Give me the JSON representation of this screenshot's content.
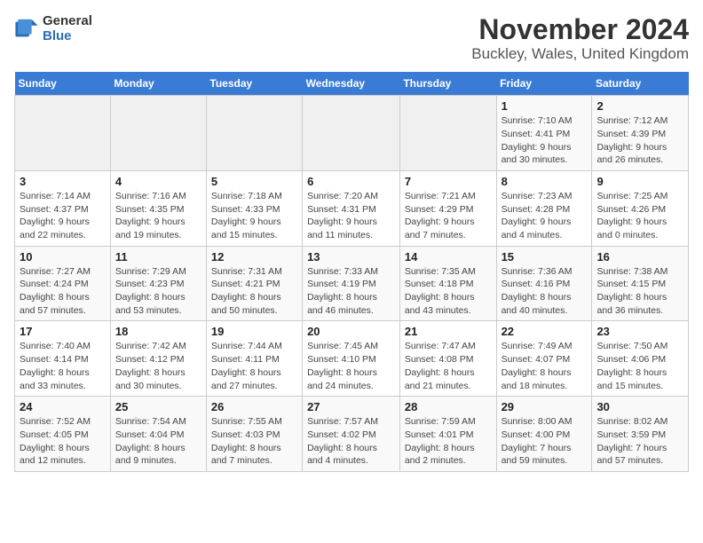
{
  "header": {
    "logo_general": "General",
    "logo_blue": "Blue",
    "title": "November 2024",
    "subtitle": "Buckley, Wales, United Kingdom"
  },
  "weekdays": [
    "Sunday",
    "Monday",
    "Tuesday",
    "Wednesday",
    "Thursday",
    "Friday",
    "Saturday"
  ],
  "weeks": [
    [
      {
        "day": "",
        "info": ""
      },
      {
        "day": "",
        "info": ""
      },
      {
        "day": "",
        "info": ""
      },
      {
        "day": "",
        "info": ""
      },
      {
        "day": "",
        "info": ""
      },
      {
        "day": "1",
        "info": "Sunrise: 7:10 AM\nSunset: 4:41 PM\nDaylight: 9 hours and 30 minutes."
      },
      {
        "day": "2",
        "info": "Sunrise: 7:12 AM\nSunset: 4:39 PM\nDaylight: 9 hours and 26 minutes."
      }
    ],
    [
      {
        "day": "3",
        "info": "Sunrise: 7:14 AM\nSunset: 4:37 PM\nDaylight: 9 hours and 22 minutes."
      },
      {
        "day": "4",
        "info": "Sunrise: 7:16 AM\nSunset: 4:35 PM\nDaylight: 9 hours and 19 minutes."
      },
      {
        "day": "5",
        "info": "Sunrise: 7:18 AM\nSunset: 4:33 PM\nDaylight: 9 hours and 15 minutes."
      },
      {
        "day": "6",
        "info": "Sunrise: 7:20 AM\nSunset: 4:31 PM\nDaylight: 9 hours and 11 minutes."
      },
      {
        "day": "7",
        "info": "Sunrise: 7:21 AM\nSunset: 4:29 PM\nDaylight: 9 hours and 7 minutes."
      },
      {
        "day": "8",
        "info": "Sunrise: 7:23 AM\nSunset: 4:28 PM\nDaylight: 9 hours and 4 minutes."
      },
      {
        "day": "9",
        "info": "Sunrise: 7:25 AM\nSunset: 4:26 PM\nDaylight: 9 hours and 0 minutes."
      }
    ],
    [
      {
        "day": "10",
        "info": "Sunrise: 7:27 AM\nSunset: 4:24 PM\nDaylight: 8 hours and 57 minutes."
      },
      {
        "day": "11",
        "info": "Sunrise: 7:29 AM\nSunset: 4:23 PM\nDaylight: 8 hours and 53 minutes."
      },
      {
        "day": "12",
        "info": "Sunrise: 7:31 AM\nSunset: 4:21 PM\nDaylight: 8 hours and 50 minutes."
      },
      {
        "day": "13",
        "info": "Sunrise: 7:33 AM\nSunset: 4:19 PM\nDaylight: 8 hours and 46 minutes."
      },
      {
        "day": "14",
        "info": "Sunrise: 7:35 AM\nSunset: 4:18 PM\nDaylight: 8 hours and 43 minutes."
      },
      {
        "day": "15",
        "info": "Sunrise: 7:36 AM\nSunset: 4:16 PM\nDaylight: 8 hours and 40 minutes."
      },
      {
        "day": "16",
        "info": "Sunrise: 7:38 AM\nSunset: 4:15 PM\nDaylight: 8 hours and 36 minutes."
      }
    ],
    [
      {
        "day": "17",
        "info": "Sunrise: 7:40 AM\nSunset: 4:14 PM\nDaylight: 8 hours and 33 minutes."
      },
      {
        "day": "18",
        "info": "Sunrise: 7:42 AM\nSunset: 4:12 PM\nDaylight: 8 hours and 30 minutes."
      },
      {
        "day": "19",
        "info": "Sunrise: 7:44 AM\nSunset: 4:11 PM\nDaylight: 8 hours and 27 minutes."
      },
      {
        "day": "20",
        "info": "Sunrise: 7:45 AM\nSunset: 4:10 PM\nDaylight: 8 hours and 24 minutes."
      },
      {
        "day": "21",
        "info": "Sunrise: 7:47 AM\nSunset: 4:08 PM\nDaylight: 8 hours and 21 minutes."
      },
      {
        "day": "22",
        "info": "Sunrise: 7:49 AM\nSunset: 4:07 PM\nDaylight: 8 hours and 18 minutes."
      },
      {
        "day": "23",
        "info": "Sunrise: 7:50 AM\nSunset: 4:06 PM\nDaylight: 8 hours and 15 minutes."
      }
    ],
    [
      {
        "day": "24",
        "info": "Sunrise: 7:52 AM\nSunset: 4:05 PM\nDaylight: 8 hours and 12 minutes."
      },
      {
        "day": "25",
        "info": "Sunrise: 7:54 AM\nSunset: 4:04 PM\nDaylight: 8 hours and 9 minutes."
      },
      {
        "day": "26",
        "info": "Sunrise: 7:55 AM\nSunset: 4:03 PM\nDaylight: 8 hours and 7 minutes."
      },
      {
        "day": "27",
        "info": "Sunrise: 7:57 AM\nSunset: 4:02 PM\nDaylight: 8 hours and 4 minutes."
      },
      {
        "day": "28",
        "info": "Sunrise: 7:59 AM\nSunset: 4:01 PM\nDaylight: 8 hours and 2 minutes."
      },
      {
        "day": "29",
        "info": "Sunrise: 8:00 AM\nSunset: 4:00 PM\nDaylight: 7 hours and 59 minutes."
      },
      {
        "day": "30",
        "info": "Sunrise: 8:02 AM\nSunset: 3:59 PM\nDaylight: 7 hours and 57 minutes."
      }
    ]
  ]
}
